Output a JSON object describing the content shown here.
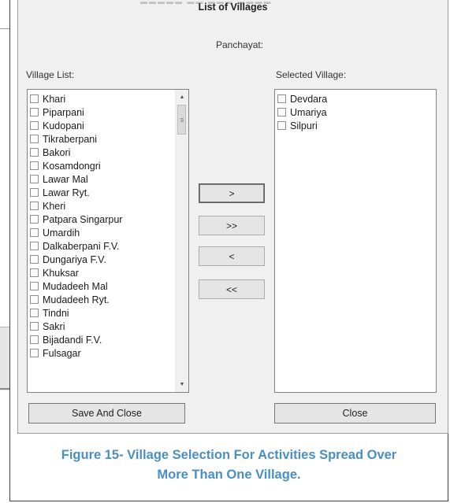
{
  "dialog": {
    "title": "List of Villages",
    "panchayat_label": "Panchayat:",
    "village_list_label": "Village List:",
    "selected_village_label": "Selected Village:",
    "village_list": [
      "Khari",
      "Piparpani",
      "Kudopani",
      "Tikraberpani",
      "Bakori",
      "Kosamdongri",
      "Lawar Mal",
      "Lawar Ryt.",
      "Kheri",
      "Patpara Singarpur",
      "Umardih",
      "Dalkaberpani F.V.",
      "Dungariya F.V.",
      "Khuksar",
      "Mudadeeh Mal",
      "Mudadeeh Ryt.",
      "Tindni",
      "Sakri",
      "Bijadandi F.V.",
      "Fulsagar"
    ],
    "selected_villages": [
      "Devdara",
      "Umariya",
      "Silpuri"
    ],
    "buttons": {
      "add": ">",
      "add_all": ">>",
      "remove": "<",
      "remove_all": "<<",
      "save_and_close": "Save And Close",
      "close": "Close"
    },
    "scroll": {
      "up_icon": "triangle-up-icon",
      "down_icon": "triangle-down-icon"
    }
  },
  "caption": {
    "line1": "Figure 15- Village Selection For Activities Spread Over",
    "line2": "More Than One Village."
  },
  "colors": {
    "caption": "#4a8fc4",
    "window": "#f0f0f0"
  }
}
